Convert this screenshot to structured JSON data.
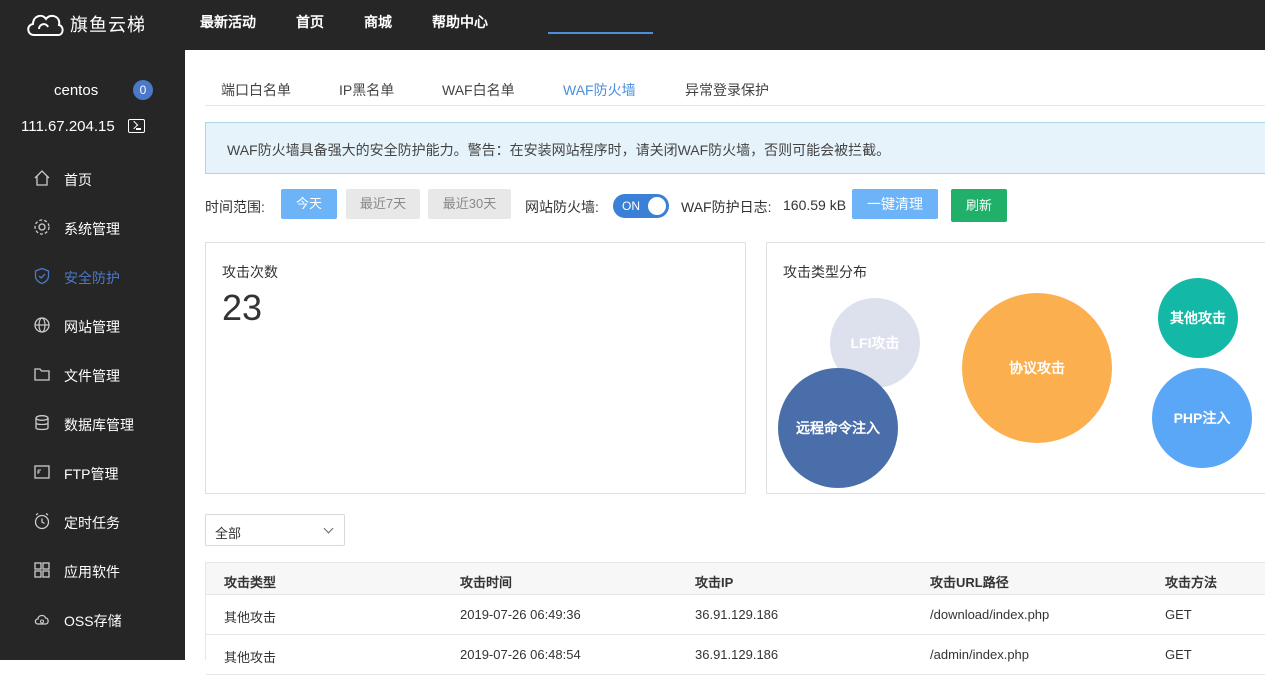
{
  "brand": {
    "name": "旗鱼云梯"
  },
  "topnav": [
    "最新活动",
    "首页",
    "商城",
    "帮助中心"
  ],
  "user": {
    "name": "centos",
    "badge": "0",
    "ip": "111.67.204.15"
  },
  "sidebar": {
    "items": [
      {
        "label": "首页",
        "icon": "home-icon"
      },
      {
        "label": "系统管理",
        "icon": "gear-icon"
      },
      {
        "label": "安全防护",
        "icon": "shield-icon",
        "active": true
      },
      {
        "label": "网站管理",
        "icon": "globe-icon"
      },
      {
        "label": "文件管理",
        "icon": "folder-icon"
      },
      {
        "label": "数据库管理",
        "icon": "database-icon"
      },
      {
        "label": "FTP管理",
        "icon": "ftp-icon"
      },
      {
        "label": "定时任务",
        "icon": "clock-icon"
      },
      {
        "label": "应用软件",
        "icon": "apps-icon"
      },
      {
        "label": "OSS存储",
        "icon": "cloud-storage-icon"
      }
    ]
  },
  "tabs": [
    "端口白名单",
    "IP黑名单",
    "WAF白名单",
    "WAF防火墙",
    "异常登录保护"
  ],
  "active_tab": "WAF防火墙",
  "notice": "WAF防火墙具备强大的安全防护能力。警告：在安装网站程序时，请关闭WAF防火墙，否则可能会被拦截。",
  "toolbar": {
    "range_label": "时间范围:",
    "today": "今天",
    "last7": "最近7天",
    "last30": "最近30天",
    "firewall_label": "网站防火墙:",
    "toggle": "ON",
    "log_label": "WAF防护日志:",
    "log_size": "160.59 kB",
    "clear": "一键清理",
    "refresh": "刷新"
  },
  "stats": {
    "attacks_title": "攻击次数",
    "attacks_count": "23",
    "types_title": "攻击类型分布"
  },
  "bubbles": [
    {
      "label": "LFI攻击",
      "color": "#dde1ee"
    },
    {
      "label": "协议攻击",
      "color": "#fbaf4f"
    },
    {
      "label": "其他攻击",
      "color": "#14b8a6"
    },
    {
      "label": "远程命令注入",
      "color": "#4a6ea9"
    },
    {
      "label": "PHP注入",
      "color": "#5ba7f7"
    }
  ],
  "filter": {
    "selected": "全部"
  },
  "table": {
    "headers": [
      "攻击类型",
      "攻击时间",
      "攻击IP",
      "攻击URL路径",
      "攻击方法"
    ],
    "rows": [
      [
        "其他攻击",
        "2019-07-26 06:49:36",
        "36.91.129.186",
        "/download/index.php",
        "GET"
      ],
      [
        "其他攻击",
        "2019-07-26 06:48:54",
        "36.91.129.186",
        "/admin/index.php",
        "GET"
      ]
    ]
  }
}
